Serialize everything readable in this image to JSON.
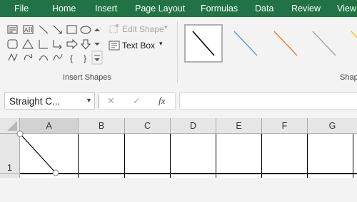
{
  "menu": {
    "tabs": [
      {
        "label": "File"
      },
      {
        "label": "Home"
      },
      {
        "label": "Insert"
      },
      {
        "label": "Page Layout"
      },
      {
        "label": "Formulas"
      },
      {
        "label": "Data"
      },
      {
        "label": "Review"
      },
      {
        "label": "View"
      }
    ]
  },
  "ribbon": {
    "insert_shapes": {
      "label": "Insert Shapes",
      "edit_shape_label": "Edit Shape",
      "text_box_label": "Text Box"
    },
    "shape_styles": {
      "label": "Shap",
      "colors": [
        "#000000",
        "#5b9bd5",
        "#ed7d31",
        "#a5a5a5",
        "#ffc000"
      ]
    }
  },
  "formula_bar": {
    "name_box_value": "Straight C...",
    "cancel_icon": "✕",
    "enter_icon": "✓",
    "fx_label": "fx",
    "formula_value": ""
  },
  "sheet": {
    "columns": [
      "A",
      "B",
      "C",
      "D",
      "E",
      "F",
      "G"
    ],
    "rows": [
      "1"
    ]
  },
  "colors": {
    "brand": "#217346",
    "selection_handle": "#808080"
  }
}
